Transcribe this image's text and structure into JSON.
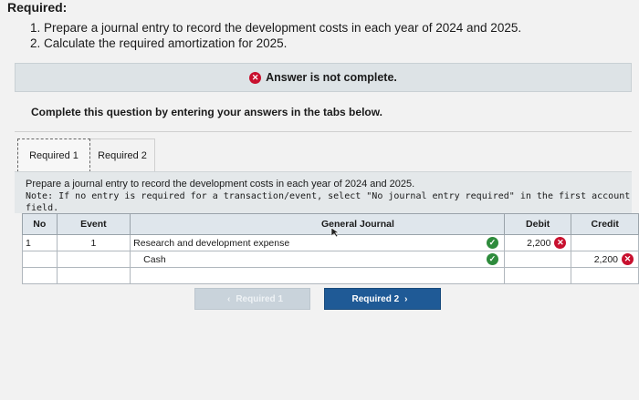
{
  "required": {
    "heading": "Required:",
    "items": [
      "1. Prepare a journal entry to record the development costs in each year of 2024 and 2025.",
      "2. Calculate the required amortization for 2025."
    ]
  },
  "status": {
    "text": "Answer is not complete."
  },
  "instruction": "Complete this question by entering your answers in the tabs below.",
  "tabs": [
    {
      "label": "Required 1"
    },
    {
      "label": "Required 2"
    }
  ],
  "panel": {
    "prompt": "Prepare a journal entry to record the development costs in each year of 2024 and 2025.",
    "note": "Note: If no entry is required for a transaction/event, select \"No journal entry required\" in the first account field."
  },
  "journal": {
    "headers": {
      "no": "No",
      "event": "Event",
      "general_journal": "General Journal",
      "debit": "Debit",
      "credit": "Credit"
    },
    "rows": [
      {
        "no": "1",
        "event": "1",
        "account": "Research and development expense",
        "debit": "2,200",
        "credit": ""
      },
      {
        "no": "",
        "event": "",
        "account": "Cash",
        "debit": "",
        "credit": "2,200"
      },
      {
        "no": "",
        "event": "",
        "account": "",
        "debit": "",
        "credit": ""
      }
    ]
  },
  "nav": {
    "prev_label": "Required 1",
    "next_label": "Required 2"
  },
  "colors": {
    "error": "#c8102e",
    "correct": "#2e8b3c",
    "primary_button": "#1f5a96"
  }
}
